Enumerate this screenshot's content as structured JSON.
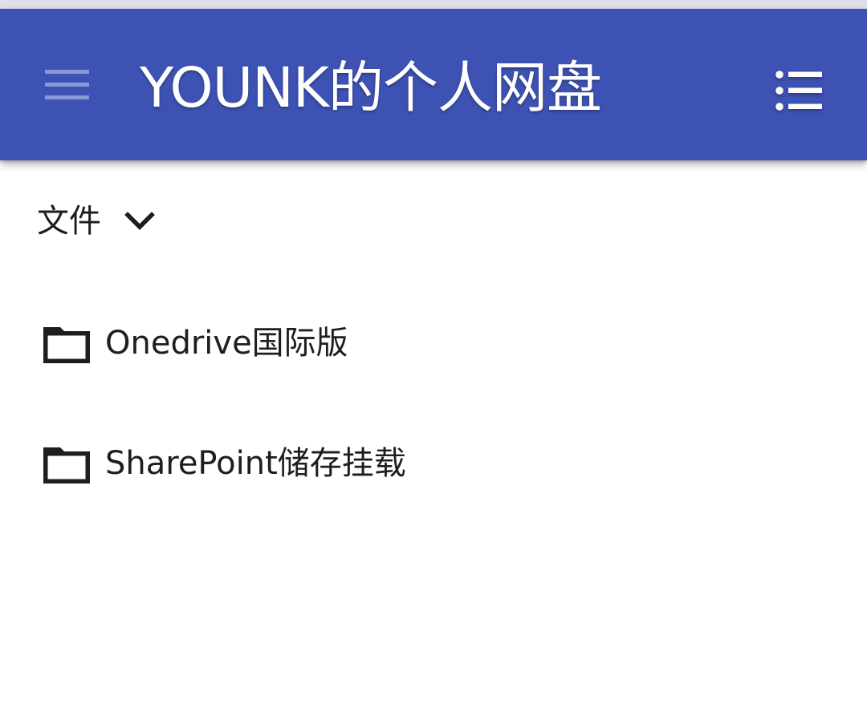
{
  "appbar": {
    "title": "YOUNK的个人网盘",
    "menu_icon": "hamburger-menu-icon",
    "view_icon": "list-view-icon",
    "background_color": "#3d52b2"
  },
  "breadcrumb": {
    "label": "文件",
    "icon": "chevron-down-icon"
  },
  "files": [
    {
      "name": "Onedrive国际版",
      "icon": "folder-icon"
    },
    {
      "name": "SharePoint储存挂载",
      "icon": "folder-icon"
    }
  ]
}
